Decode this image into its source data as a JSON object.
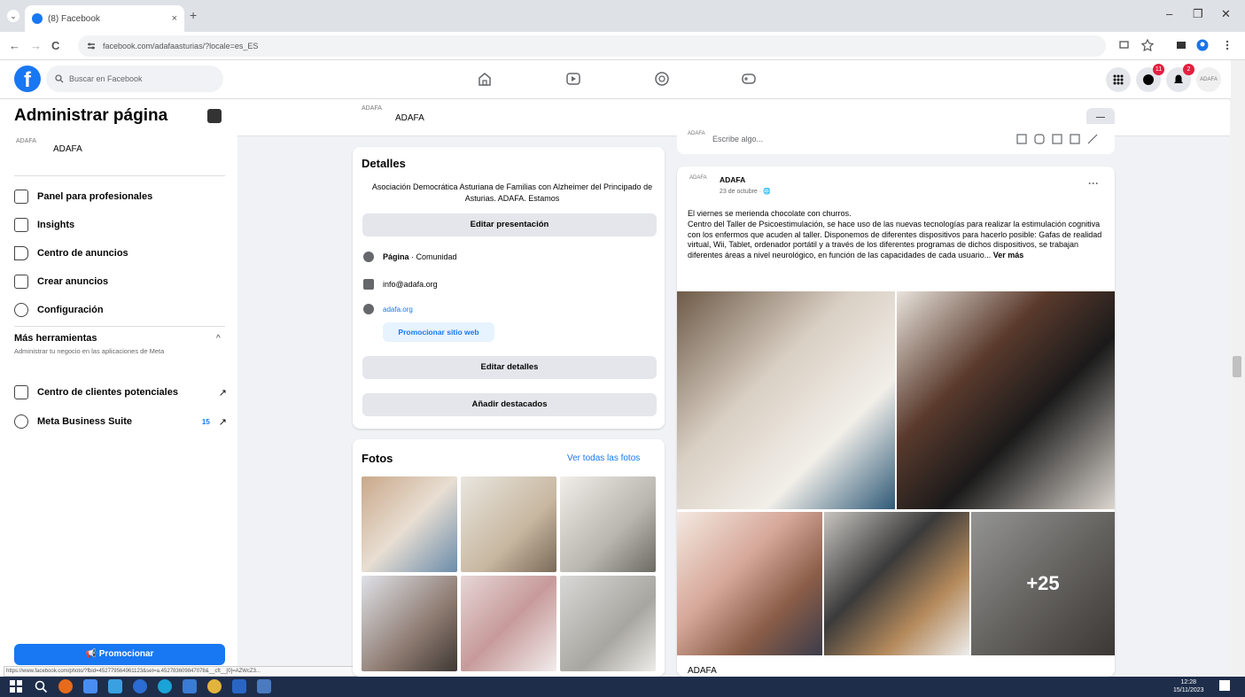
{
  "browser": {
    "tab_title": "(8) Facebook",
    "url": "facebook.com/adafaasturias/?locale=es_ES",
    "tab_close": "×",
    "new_tab": "+",
    "menu": "⌄",
    "window_minimize": "–",
    "window_restore": "❐",
    "window_close": "✕",
    "back": "←",
    "forward": "→",
    "reload": "C"
  },
  "fb": {
    "logo": "f",
    "search_placeholder": "Buscar en Facebook",
    "messenger_badge": "11",
    "notifications_badge": "2"
  },
  "sidebar": {
    "title": "Administrar página",
    "page_name": "ADAFA",
    "avatar_text": "ADAFA",
    "items": [
      {
        "label": "Panel para profesionales"
      },
      {
        "label": "Insights"
      },
      {
        "label": "Centro de anuncios"
      },
      {
        "label": "Crear anuncios"
      },
      {
        "label": "Configuración"
      }
    ],
    "more_tools_title": "Más herramientas",
    "more_tools_desc": "Administrar tu negocio en las aplicaciones de Meta",
    "tools": [
      {
        "label": "Centro de clientes potenciales",
        "arrow": "↗"
      },
      {
        "label": "Meta Business Suite",
        "count": "15",
        "arrow": "↗"
      }
    ],
    "promote_label": "📢 Promocionar",
    "status_url": "https://www.facebook.com/photo/?fbid=452779564961123&set=a.452783609847078&__cft__[0]=AZWcZ3..."
  },
  "page_header": {
    "name": "ADAFA",
    "more": "—"
  },
  "details": {
    "title": "Detalles",
    "description": "Asociación Democrática Asturiana de Familias con Alzheimer del Principado de Asturias. ADAFA. Estamos",
    "edit_presentation": "Editar presentación",
    "category_label": "Página",
    "category_value": " · Comunidad",
    "email": "info@adafa.org",
    "website": "adafa.org",
    "promote_site": "Promocionar sitio web",
    "edit_details": "Editar detalles",
    "add_featured": "Añadir destacados"
  },
  "photos": {
    "title": "Fotos",
    "see_all": "Ver todas las fotos"
  },
  "composer": {
    "placeholder": "Escribe algo..."
  },
  "post": {
    "author": "ADAFA",
    "date": "23 de octubre · 🌐",
    "more": "···",
    "text_line1": "El viernes se merienda chocolate con churros.",
    "text_body": "Centro del Taller de Psicoestimulación, se hace uso de las nuevas tecnologías para realizar la estimulación cognitiva con los enfermos que acuden al taller. Disponemos de diferentes dispositivos para hacerlo posible: Gafas de realidad virtual, Wii, Tablet, ordenador portátil y a través de los diferentes programas de dichos dispositivos, se trabajan diferentes áreas a nivel neurológico, en función de las capacidades de cada usuario...",
    "see_more": " Ver más",
    "extra_photos": "+25",
    "footer_name": "ADAFA"
  },
  "taskbar": {
    "time": "12:28",
    "date": "15/11/2023"
  }
}
